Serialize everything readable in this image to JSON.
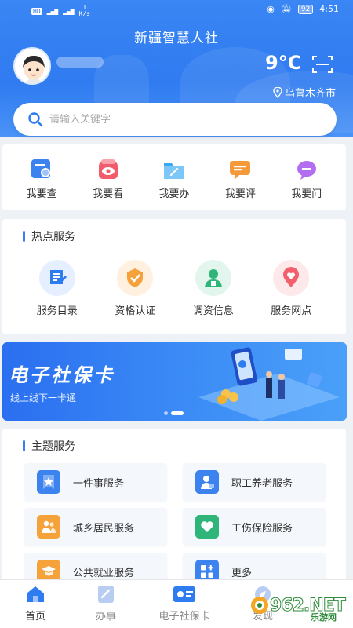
{
  "status_bar": {
    "net_badge": "HD",
    "net_speed": "1",
    "net_speed_unit": "K/s",
    "battery": "92",
    "time": "4:51"
  },
  "header": {
    "app_title": "新疆智慧人社",
    "temperature": "9°C",
    "location": "乌鲁木齐市"
  },
  "search": {
    "placeholder": "请输入关键字"
  },
  "quick_actions": [
    {
      "label": "我要查",
      "icon": "search-doc-icon",
      "color": "#3d83f0"
    },
    {
      "label": "我要看",
      "icon": "eye-icon",
      "color": "#f25b6b"
    },
    {
      "label": "我要办",
      "icon": "folder-edit-icon",
      "color": "#3aa8f0"
    },
    {
      "label": "我要评",
      "icon": "comment-icon",
      "color": "#f59a3b"
    },
    {
      "label": "我要问",
      "icon": "question-bubble-icon",
      "color": "#b36df0"
    }
  ],
  "hot_services": {
    "title": "热点服务",
    "items": [
      {
        "label": "服务目录",
        "icon": "catalog-icon",
        "color": "#2f7bf0",
        "bg": "#e6efff"
      },
      {
        "label": "资格认证",
        "icon": "certify-icon",
        "color": "#f5a23a",
        "bg": "#fff0e0"
      },
      {
        "label": "调资信息",
        "icon": "salary-info-icon",
        "color": "#2fb57a",
        "bg": "#e3f6ed"
      },
      {
        "label": "服务网点",
        "icon": "location-heart-icon",
        "color": "#f2606e",
        "bg": "#fde8ea"
      }
    ]
  },
  "banner": {
    "title": "电子社保卡",
    "subtitle": "线上线下一卡通"
  },
  "theme_services": {
    "title": "主题服务",
    "items": [
      {
        "label": "一件事服务",
        "icon": "star-badge-icon",
        "color": "#3d83f0"
      },
      {
        "label": "职工养老服务",
        "icon": "worker-icon",
        "color": "#3d83f0"
      },
      {
        "label": "城乡居民服务",
        "icon": "residents-icon",
        "color": "#f5a23a"
      },
      {
        "label": "工伤保险服务",
        "icon": "heart-icon",
        "color": "#2fb57a"
      },
      {
        "label": "公共就业服务",
        "icon": "graduation-icon",
        "color": "#f5a23a"
      },
      {
        "label": "更多",
        "icon": "grid-plus-icon",
        "color": "#3d83f0"
      }
    ]
  },
  "bottom_nav": [
    {
      "label": "首页",
      "icon": "home-icon",
      "active": true
    },
    {
      "label": "办事",
      "icon": "edit-doc-icon",
      "active": false
    },
    {
      "label": "电子社保卡",
      "icon": "social-card-icon",
      "active": false
    },
    {
      "label": "发现",
      "icon": "discover-icon",
      "active": false
    }
  ],
  "watermark": {
    "text": "962.NET",
    "sub": "乐游网"
  }
}
